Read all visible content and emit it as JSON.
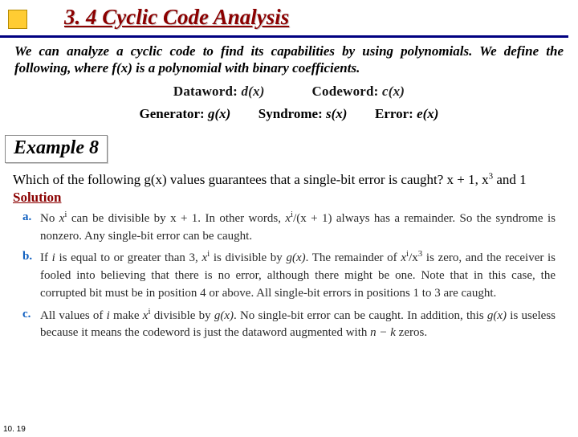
{
  "title": "3. 4  Cyclic Code Analysis",
  "intro": "We can analyze a cyclic code to find its capabilities by using polynomials. We define the following, where f(x) is a polynomial with binary coefficients.",
  "defs": {
    "dataword_label": "Dataword:",
    "dataword_fn": "d(x)",
    "codeword_label": "Codeword:",
    "codeword_fn": "c(x)",
    "generator_label": "Generator:",
    "generator_fn": "g(x)",
    "syndrome_label": "Syndrome:",
    "syndrome_fn": "s(x)",
    "error_label": "Error:",
    "error_fn": "e(x)"
  },
  "example_label": "Example 8",
  "question_pre": "Which of the following g(x) values guarantees that a single-bit error is caught? x + 1, x",
  "question_exp": "3",
  "question_post": " and  1",
  "solution_label": "Solution",
  "answers": {
    "a": {
      "marker": "a.",
      "t1": "No ",
      "xi1": "x",
      "e1": "i",
      "t2": " can be divisible by x + 1. In other words, ",
      "xi2": "x",
      "e2": "i",
      "t3": "/(x + 1) always has a remainder. So the syndrome is nonzero. Any single-bit error can be caught."
    },
    "b": {
      "marker": "b.",
      "t1": "If ",
      "ivar": "i",
      "t2": " is equal to or greater than 3, ",
      "xi1": "x",
      "e1": "i",
      "t3": " is divisible by ",
      "gx": "g(x)",
      "t4": ". The remainder of ",
      "xi2": "x",
      "e2": "i",
      "t5": "/x",
      "e3": "3",
      "t6": " is zero, and the receiver is fooled into believing that there is no error, although there might be one. Note that in this case, the corrupted bit must be in position 4 or above. All single-bit errors in positions 1 to 3 are caught."
    },
    "c": {
      "marker": "c.",
      "t1": "All values of ",
      "ivar": "i",
      "t2": " make ",
      "xi1": "x",
      "e1": "i",
      "t3": " divisible by ",
      "gx": "g(x)",
      "t4": ". No single-bit error can be caught. In addition, this ",
      "gx2": "g(x)",
      "t5": " is useless because it means the codeword is just the dataword augmented with ",
      "nk": "n − k",
      "t6": " zeros."
    }
  },
  "page_number": "10. 19"
}
